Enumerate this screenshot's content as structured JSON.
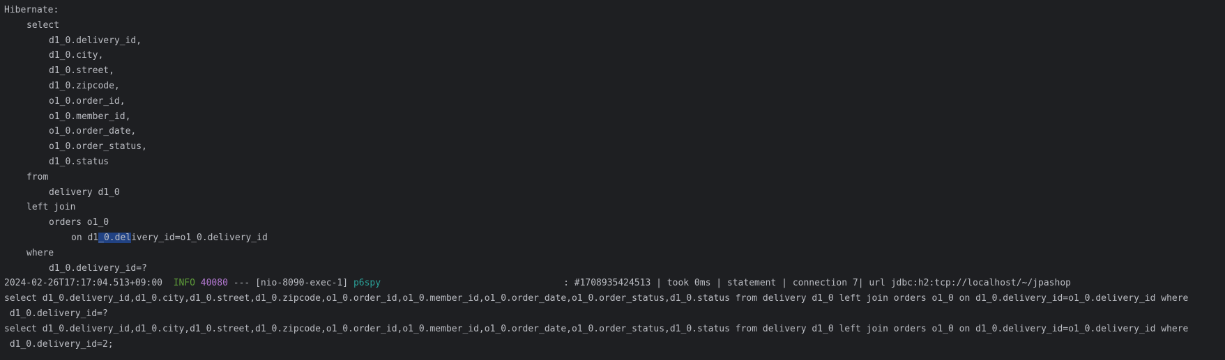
{
  "hibernate": {
    "header": "Hibernate:",
    "select_kw": "select",
    "columns": [
      "d1_0.delivery_id,",
      "d1_0.city,",
      "d1_0.street,",
      "d1_0.zipcode,",
      "o1_0.order_id,",
      "o1_0.member_id,",
      "o1_0.order_date,",
      "o1_0.order_status,",
      "d1_0.status"
    ],
    "from_kw": "from",
    "from_table": "delivery d1_0",
    "join_kw": "left join",
    "join_table": "orders o1_0",
    "on_prefix": "on d1",
    "on_selected": "_0.del",
    "on_suffix": "ivery_id=o1_0.delivery_id",
    "where_kw": "where",
    "where_cond": "d1_0.delivery_id=?"
  },
  "log": {
    "timestamp": "2024-02-26T17:17:04.513+09:00",
    "level": "INFO",
    "pid": "40080",
    "sep": "---",
    "thread": "[nio-8090-exec-1]",
    "logger": "p6spy",
    "message": ": #1708935424513 | took 0ms | statement | connection 7| url jdbc:h2:tcp://localhost/~/jpashop"
  },
  "sql_lines": [
    "select d1_0.delivery_id,d1_0.city,d1_0.street,d1_0.zipcode,o1_0.order_id,o1_0.member_id,o1_0.order_date,o1_0.order_status,d1_0.status from delivery d1_0 left join orders o1_0 on d1_0.delivery_id=o1_0.delivery_id where",
    " d1_0.delivery_id=?",
    "select d1_0.delivery_id,d1_0.city,d1_0.street,d1_0.zipcode,o1_0.order_id,o1_0.member_id,o1_0.order_date,o1_0.order_status,d1_0.status from delivery d1_0 left join orders o1_0 on d1_0.delivery_id=o1_0.delivery_id where",
    " d1_0.delivery_id=2;"
  ],
  "colors": {
    "background": "#1e1f22",
    "text": "#bcbec4",
    "selection": "#214283",
    "info": "#5f9e3a",
    "pid": "#b57ad4",
    "logger": "#2aa198"
  }
}
